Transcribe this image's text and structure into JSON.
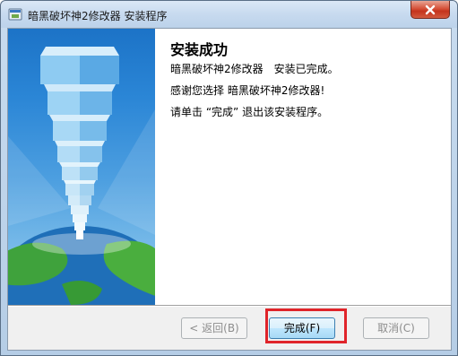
{
  "window": {
    "title": "暗黑破坏神2修改器 安装程序"
  },
  "content": {
    "heading": "安装成功",
    "line1": "暗黑破坏神2修改器　安装已完成。",
    "line2": "感谢您选择 暗黑破坏神2修改器!",
    "line3": "请单击 “完成” 退出该安装程序。"
  },
  "buttons": {
    "back": "< 返回(B)",
    "finish": "完成(F)",
    "cancel": "取消(C)"
  },
  "colors": {
    "highlight": "#e0242a",
    "banner_top": "#1c73c7",
    "close_red": "#c4331d"
  },
  "icons": {
    "window": "installer-icon",
    "close": "close-icon"
  }
}
